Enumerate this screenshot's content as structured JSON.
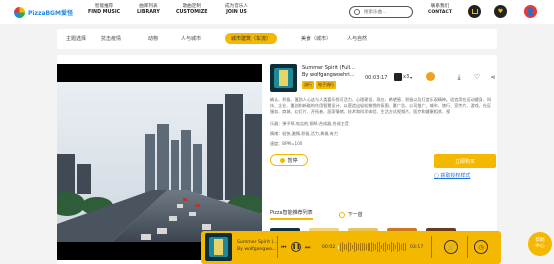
{
  "brand": {
    "name": "PizzaBGM爱怪"
  },
  "nav": [
    {
      "cn": "智能推荐",
      "en": "FIND MUSIC"
    },
    {
      "cn": "曲库列表",
      "en": "LIBRARY"
    },
    {
      "cn": "歌曲定制",
      "en": "CUSTOMIZE"
    },
    {
      "cn": "成为音乐人",
      "en": "JOIN US"
    }
  ],
  "search": {
    "placeholder": "搜索乐曲..."
  },
  "contact": {
    "cn": "联系我们",
    "en": "CONTACT"
  },
  "categories": [
    "主题选择",
    "抗击疫情",
    "动物",
    "人与城市",
    "城市建筑（车流）",
    "美食（城市）",
    "人与自然"
  ],
  "active_category_index": 4,
  "track": {
    "title": "Summer Spirit (Full...",
    "author": "By wolfgangwoehri...",
    "tags": [
      "流行",
      "电子流行"
    ],
    "duration": "00:03:17",
    "version_count": "x3",
    "description": "确认、积极、蓬勃人心这与人类喜乐悦可活力、心理建设、现在、希望感、积极以及打造乐观精神。适宜用在运动健身、科技、企业、重创和新能的作用智慧设计、以营造出轻松愉悦的氛围、夏广告、公司推广、城市、旅行、宣传片、游戏、社区服务、商城、幻灯片、开拓者、居家情绪、技术和科学体验、生活方式视频片、医疗和健康相关、视",
    "mood": "乐器：弹子琴,电吉他,钢琴,合成器,合成主音",
    "scene": "情绪：轻快,激情,积极,活力,勇敢,有力",
    "tempo": "速度：BPM=100"
  },
  "buttons": {
    "pause": "暂停",
    "buy": "立即购买",
    "sample": "获取授权样式"
  },
  "recommend": {
    "title": "Pizza智能推荐列表",
    "next": "下一首"
  },
  "player": {
    "title": "Summer Spirit (...",
    "author": "By wolfgangwo...",
    "current": "00:02",
    "total": "03:17",
    "progress": 0.02
  },
  "help": {
    "line1": "帮助",
    "line2": "中心"
  },
  "colors": {
    "accent": "#f5b800",
    "link": "#1e6fd9",
    "avatar": "#e53935"
  }
}
